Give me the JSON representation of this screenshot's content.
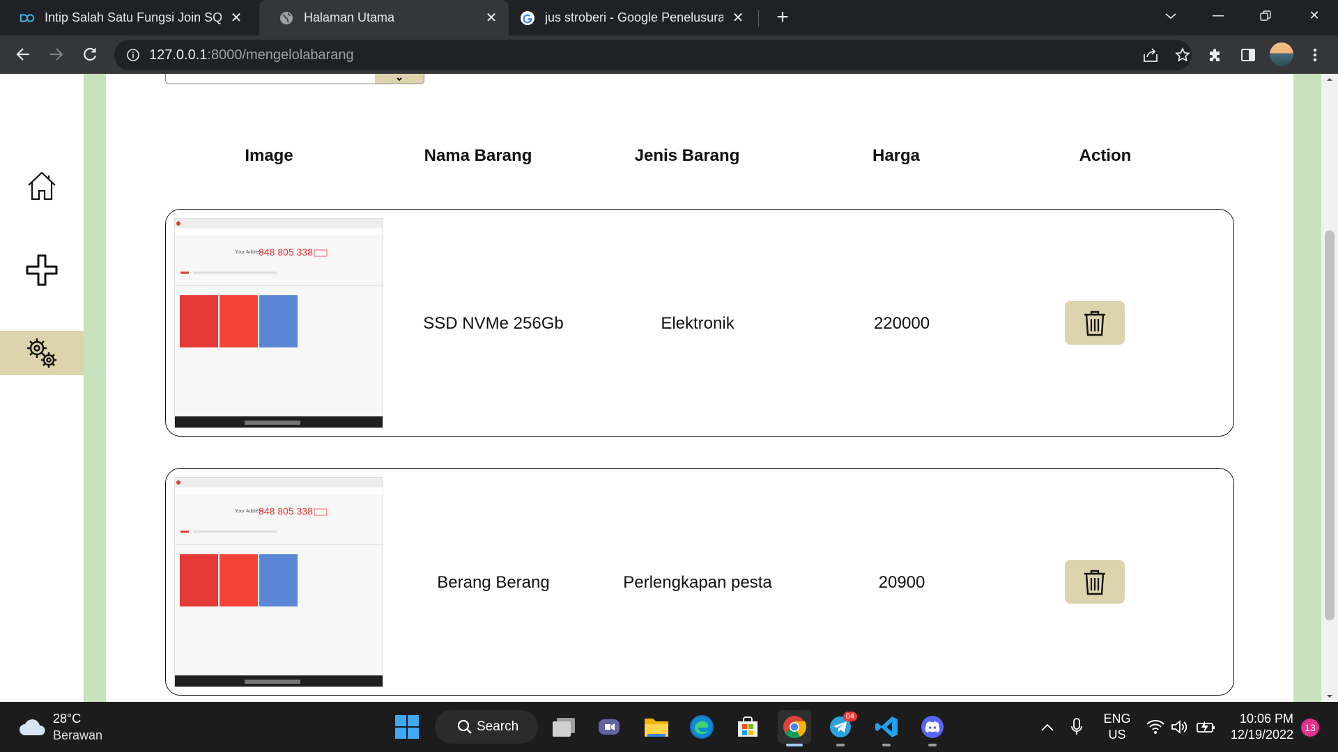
{
  "browser": {
    "tabs": [
      {
        "title": "Intip Salah Satu Fungsi Join SQL,",
        "favicon": "dicoding-logo"
      },
      {
        "title": "Halaman Utama",
        "favicon": "globe-icon"
      },
      {
        "title": "jus stroberi - Google Penelusuran",
        "favicon": "google-logo"
      }
    ],
    "url_host": "127.0.0.1",
    "url_path": ":8000/mengelolabarang"
  },
  "table": {
    "headers": [
      "Image",
      "Nama Barang",
      "Jenis Barang",
      "Harga",
      "Action"
    ],
    "rows": [
      {
        "nama": "SSD NVMe 256Gb",
        "jenis": "Elektronik",
        "harga": "220000"
      },
      {
        "nama": "Berang Berang",
        "jenis": "Perlengkapan pesta",
        "harga": "20900"
      }
    ]
  },
  "thumbnail": {
    "title_prefix": "Your Address",
    "number": "848 805 338"
  },
  "taskbar": {
    "weather_temp": "28°C",
    "weather_desc": "Berawan",
    "search_label": "Search",
    "lang": "ENG",
    "region": "US",
    "time": "10:06 PM",
    "date": "12/19/2022",
    "notif_count": "13",
    "telegram_badge": "04"
  },
  "colors": {
    "accent_tan": "#ddd3ad",
    "page_green": "#c7e2bc",
    "chrome_dark": "#202124"
  }
}
